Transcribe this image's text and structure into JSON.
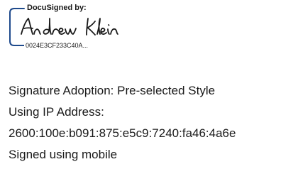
{
  "signature": {
    "header": "DocuSigned by:",
    "signer_name": "Andrew Klein",
    "envelope_id": "0024E3CF233C40A..."
  },
  "details": {
    "adoption": "Signature Adoption: Pre-selected Style",
    "ip_label": "Using IP Address:",
    "ip_address": "2600:100e:b091:875:e5c9:7240:fa46:4a6e",
    "device": "Signed using mobile"
  },
  "colors": {
    "bracket": "#1e4a8c",
    "ink": "#1a1a1a"
  }
}
